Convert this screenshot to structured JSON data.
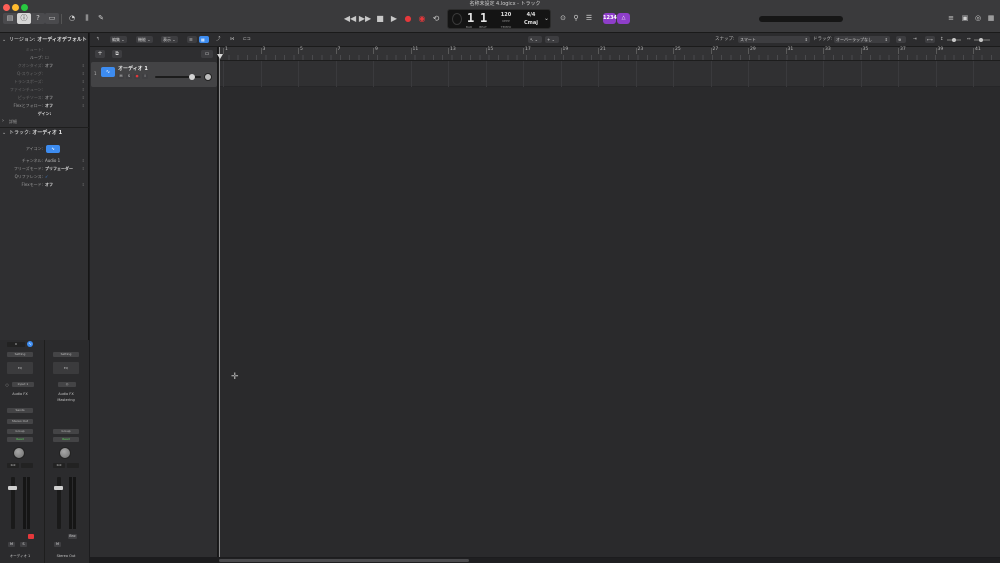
{
  "window": {
    "document_title": "名称未設定 4.logicx - トラック",
    "traffic_colors": [
      "#ff5f57",
      "#febc2e",
      "#28c840"
    ]
  },
  "lcd": {
    "bar": "1",
    "beat": "1",
    "tempo": "120",
    "tempo_unit": "KEEP",
    "signature": "4/4",
    "key": "Cmaj",
    "bar_label": "BAR",
    "beat_label": "BEAT",
    "tempo_label": "TEMPO"
  },
  "badges": {
    "purple": "1234"
  },
  "inspector": {
    "region_header": {
      "prefix": "リージョン:",
      "name": "オーディオデフォルト"
    },
    "region_rows": [
      {
        "label": "ミュート:",
        "value": "",
        "dim": true
      },
      {
        "label": "ループ:",
        "value": "",
        "dim": false
      },
      {
        "label": "クオンタイズ:",
        "value": "オフ",
        "dim": true
      },
      {
        "label": "Q-スウィング:",
        "value": "",
        "dim": true
      },
      {
        "label": "トランスポーズ:",
        "value": "",
        "dim": true
      },
      {
        "label": "ファインチューン:",
        "value": "",
        "dim": true
      },
      {
        "label": "ピッチソース:",
        "value": "オフ",
        "dim": true
      },
      {
        "label": "Flexとフォロー:",
        "value": "オフ",
        "dim": false
      },
      {
        "label": "",
        "value": "ゲイン:",
        "dim": false
      }
    ],
    "more_label": "詳細",
    "track_header": {
      "prefix": "トラック:",
      "name": "オーディオ 1"
    },
    "track_rows": [
      {
        "label": "アイコン:",
        "value": ""
      },
      {
        "label": "チャンネル:",
        "value": "Audio 1"
      },
      {
        "label": "フリーズモード:",
        "value": "プリフェーダー"
      },
      {
        "label": "Qリファレンス:",
        "value": "✓"
      },
      {
        "label": "Flexモード:",
        "value": "オフ"
      }
    ]
  },
  "strips": [
    {
      "gain": "0",
      "setting": "Setting",
      "eq": "EQ",
      "input": "Input 1",
      "audio_fx": "Audio FX",
      "sends": "Sends",
      "output": "Stereo Out",
      "group": "Group",
      "automation": "Read",
      "volume": "0.0",
      "mute": "M",
      "solo": "S",
      "name": "オーディオ 1",
      "level_fraction": 0.78
    },
    {
      "setting": "Setting",
      "eq": "EQ",
      "input": "",
      "audio_fx": "Audio FX",
      "audio_fx2": "Mastering",
      "group": "Group",
      "automation": "Read",
      "volume": "0.0",
      "mute": "M",
      "bounce": "Bnc",
      "name": "Stereo Out",
      "level_fraction": 0.78
    }
  ],
  "localbar": {
    "edit": "編集",
    "functions": "機能",
    "view": "表示",
    "snap_label": "スナップ:",
    "snap_value": "スマート",
    "drag_label": "ドラッグ:",
    "drag_value": "オーバーラップなし"
  },
  "track": {
    "number": "1",
    "name": "オーディオ 1",
    "mute": "M",
    "solo": "S",
    "record": "R",
    "input_monitor": "I",
    "volume_fraction": 0.8
  },
  "ruler_bars": [
    "1",
    "3",
    "5",
    "7",
    "9",
    "11",
    "13",
    "15",
    "17",
    "19",
    "21",
    "23",
    "25",
    "27",
    "29",
    "31",
    "33",
    "35",
    "37",
    "39",
    "41"
  ],
  "colors": {
    "accent_blue": "#3d8cf0",
    "record_red": "#e5383b",
    "purple_badge": "#8e3ec9",
    "read_green": "#5fd35f"
  }
}
